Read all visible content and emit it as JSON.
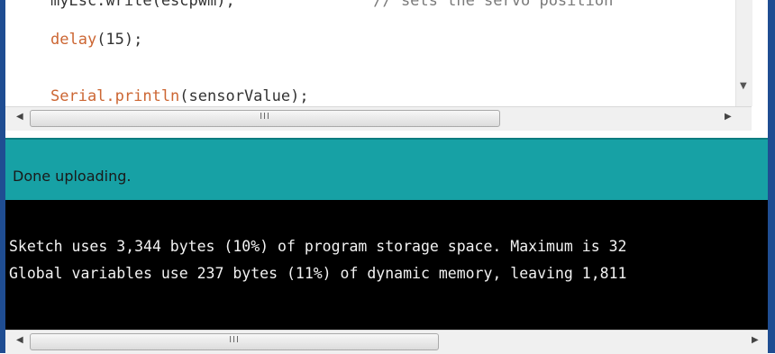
{
  "editor": {
    "lines": [
      {
        "fn": "myEsc.write(escpwm);",
        "pad": "               ",
        "comment": "// sets the servo position"
      },
      {
        "fn": "delay",
        "args": "(15);"
      },
      {
        "fn": "Serial.println",
        "args": "(sensorValue);"
      }
    ]
  },
  "status": {
    "message": "Done uploading."
  },
  "console": {
    "lines": [
      "Sketch uses 3,344 bytes (10%) of program storage space. Maximum is 32",
      "Global variables use 237 bytes (11%) of dynamic memory, leaving 1,811"
    ]
  },
  "scrollbars": {
    "left_arrow": "◀",
    "right_arrow": "▶",
    "down_arrow": "▼",
    "grip": "III"
  },
  "colors": {
    "status_bar": "#17a1a5",
    "console_bg": "#000000",
    "keyword": "#cc6633",
    "frame": "#1f4d92"
  }
}
